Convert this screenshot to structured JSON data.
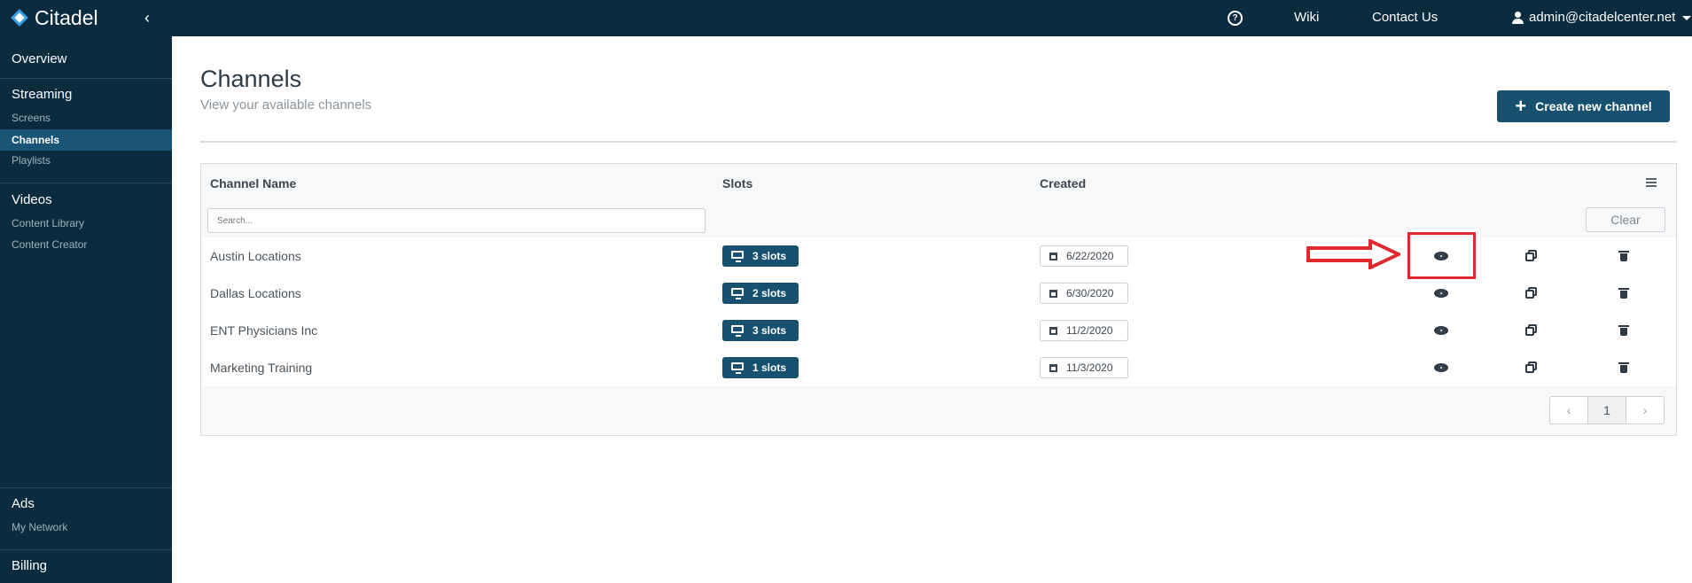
{
  "app": {
    "name": "Citadel",
    "collapse_glyph": "‹"
  },
  "topnav": {
    "help_glyph": "?",
    "wiki": "Wiki",
    "contact": "Contact Us",
    "user_email": "admin@citadelcenter.net"
  },
  "sidebar": {
    "overview": "Overview",
    "streaming": "Streaming",
    "streaming_items": [
      "Screens",
      "Channels",
      "Playlists"
    ],
    "videos": "Videos",
    "video_items": [
      "Content Library",
      "Content Creator"
    ],
    "ads": "Ads",
    "ads_items": [
      "My Network"
    ],
    "billing": "Billing",
    "active_item": "Channels"
  },
  "page": {
    "title": "Channels",
    "subtitle": "View your available channels",
    "create_button": "Create new channel",
    "create_plus": "+"
  },
  "table": {
    "headers": {
      "name": "Channel Name",
      "slots": "Slots",
      "created": "Created"
    },
    "search_placeholder": "Search...",
    "clear_label": "Clear",
    "rows": [
      {
        "name": "Austin Locations",
        "slots": "3 slots",
        "created": "6/22/2020"
      },
      {
        "name": "Dallas Locations",
        "slots": "2 slots",
        "created": "6/30/2020"
      },
      {
        "name": "ENT Physicians Inc",
        "slots": "3 slots",
        "created": "11/2/2020"
      },
      {
        "name": "Marketing Training",
        "slots": "1 slots",
        "created": "11/3/2020"
      }
    ],
    "pagination": {
      "prev": "‹",
      "current": "1",
      "next": "›"
    }
  },
  "colors": {
    "nav_bg": "#0b2b3f",
    "accent": "#17516f",
    "annotation": "#e0282e"
  }
}
